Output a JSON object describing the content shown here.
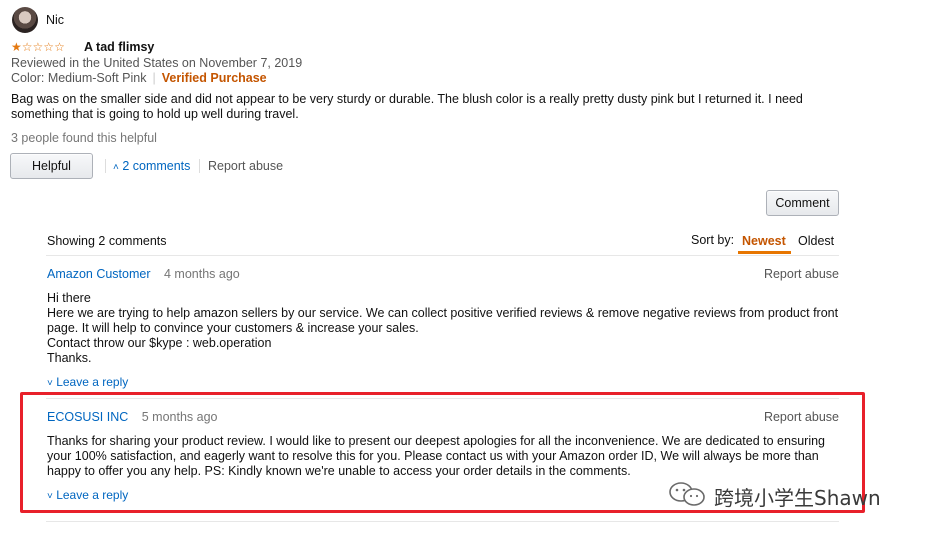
{
  "review": {
    "username": "Nic",
    "rating_stars": 1,
    "rating_max": 5,
    "title": "A tad flimsy",
    "reviewed_in": "Reviewed in the United States on November 7, 2019",
    "variant": "Color: Medium-Soft Pink",
    "verified": "Verified Purchase",
    "body": "Bag was on the smaller side and did not appear to be very sturdy or durable. The blush color is a really pretty dusty pink but I returned it. I need something that is going to hold up well during travel.",
    "helpful_count": "3 people found this helpful",
    "helpful_button": "Helpful",
    "comments_toggle": "2 comments",
    "report_abuse": "Report abuse"
  },
  "comments_section": {
    "comment_button": "Comment",
    "showing": "Showing 2 comments",
    "sort_by_label": "Sort by:",
    "sort_newest": "Newest",
    "sort_oldest": "Oldest",
    "items": [
      {
        "author": "Amazon Customer",
        "time": "4 months ago",
        "report": "Report abuse",
        "lines": [
          "Hi there",
          "Here we are trying to help amazon sellers by our service. We can collect positive verified reviews & remove negative reviews from product front page. It will help to convince your customers & increase your sales.",
          "Contact throw our $kype : web.operation",
          "Thanks."
        ],
        "reply": "Leave a reply"
      },
      {
        "author": "ECOSUSI INC",
        "time": "5 months ago",
        "report": "Report abuse",
        "lines": [
          "Thanks for sharing your product review. I would like to present our deepest apologies for all the inconvenience. We are dedicated to ensuring your 100% satisfaction, and eagerly want to resolve this for you. Please contact us with your Amazon order ID, We will always be more than happy to offer you any help. PS: Kindly known we're unable to access your order details in the comments."
        ],
        "reply": "Leave a reply"
      }
    ]
  },
  "watermark": {
    "text": "跨境小学生Shawn",
    "icon": "wechat-icon"
  },
  "colors": {
    "link": "#0066c0",
    "verified": "#c45500",
    "star": "#e47911",
    "highlight": "#e8202a"
  }
}
